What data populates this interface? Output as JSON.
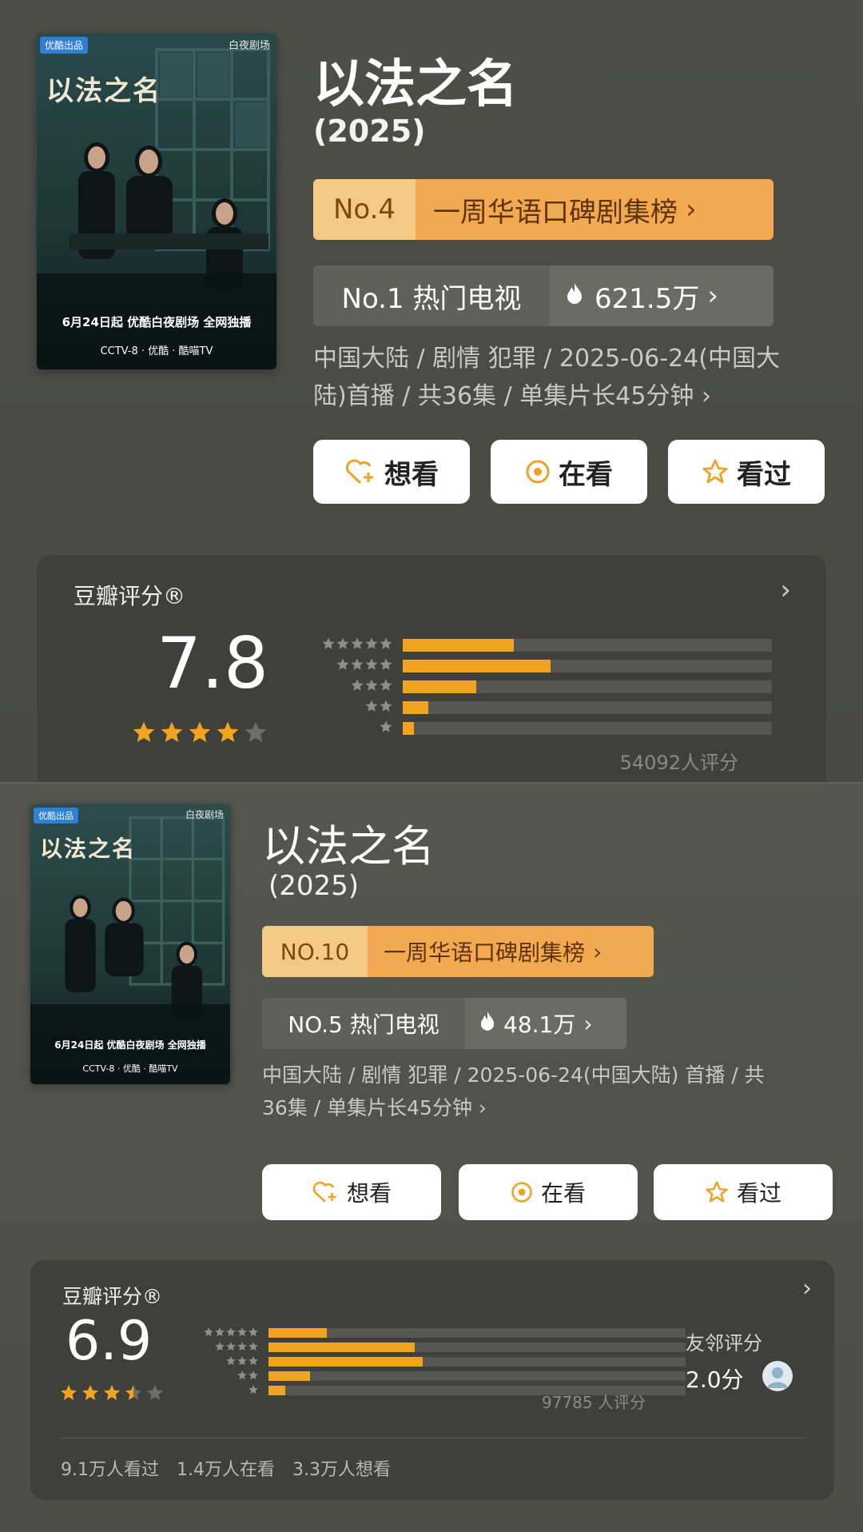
{
  "panels": [
    {
      "poster": {
        "badge": "优酷出品",
        "logo": "白夜剧场",
        "title_art": "以法之名",
        "tagline": "6月24日起  优酷白夜剧场  全网独播",
        "platforms": "CCTV-8 · 优酷 · 酷喵TV"
      },
      "title": "以法之名",
      "year": "(2025)",
      "rank": {
        "no": "No.4",
        "name": "一周华语口碑剧集榜"
      },
      "hot": {
        "no": "No.1 热门电视",
        "value": "621.5万"
      },
      "meta_line1": "中国大陆 / 剧情 犯罪 / 2025-06-24(中国大",
      "meta_line2": "陆)首播 / 共36集 / 单集片长45分钟",
      "buttons": {
        "want": "想看",
        "watching": "在看",
        "watched": "看过"
      },
      "rating": {
        "label": "豆瓣评分®",
        "score": "7.8",
        "stars": 4,
        "distribution": [
          0.3,
          0.4,
          0.2,
          0.07,
          0.03
        ],
        "count": "54092人评分"
      }
    },
    {
      "poster": {
        "badge": "优酷出品",
        "logo": "白夜剧场",
        "title_art": "以法之名",
        "tagline": "6月24日起  优酷白夜剧场  全网独播",
        "platforms": "CCTV-8 · 优酷 · 酷喵TV"
      },
      "title": "以法之名",
      "year": "(2025)",
      "rank": {
        "no": "NO.10",
        "name": "一周华语口碑剧集榜"
      },
      "hot": {
        "no": "NO.5 热门电视",
        "value": "48.1万"
      },
      "meta_line1": "中国大陆 / 剧情 犯罪 / 2025-06-24(中国大陆) 首播 / 共",
      "meta_line2": "36集 / 单集片长45分钟",
      "buttons": {
        "want": "想看",
        "watching": "在看",
        "watched": "看过"
      },
      "rating": {
        "label": "豆瓣评分®",
        "score": "6.9",
        "stars": 3.5,
        "distribution": [
          0.14,
          0.35,
          0.37,
          0.1,
          0.04
        ],
        "count": "97785 人评分",
        "friend_label": "友邻评分",
        "friend_score": "2.0分",
        "stats": [
          "9.1万人看过",
          "1.4万人在看",
          "3.3万人想看"
        ]
      }
    }
  ],
  "colors": {
    "accent": "#f0a41f",
    "rank_no_bg": "#f4c983",
    "rank_bg": "#f3a94f",
    "card_bg": "#3f403b"
  },
  "icons": [
    "heart-plus-icon",
    "target-icon",
    "star-outline-icon",
    "fire-icon",
    "chevron-right-icon",
    "avatar"
  ]
}
